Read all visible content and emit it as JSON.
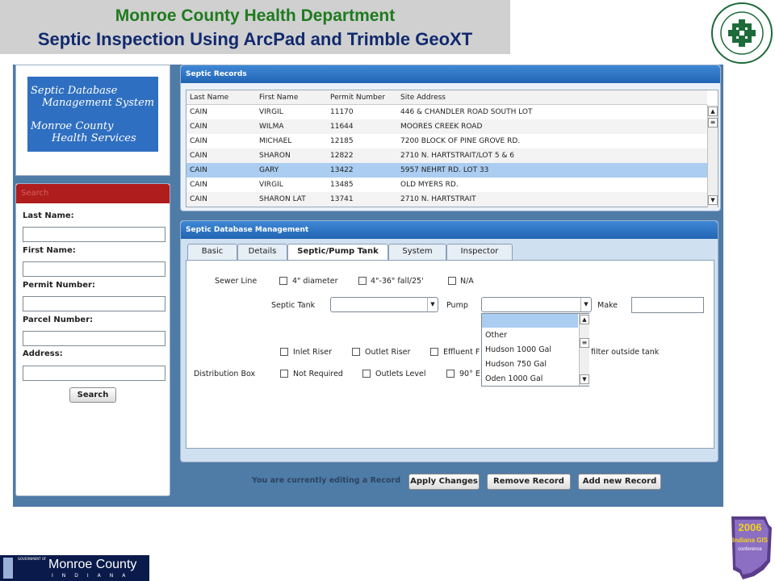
{
  "slide": {
    "title_line1": "Monroe County Health Department",
    "title_line2": "Septic Inspection Using ArcPad and Trimble GeoXT",
    "seal_text_top": "MONROE 1965 COUNTY",
    "seal_text_bottom": "HEALTH DEPARTMENT",
    "footer_logo": {
      "small": "GOVERNMENT OF",
      "name": "Monroe County",
      "state": "INDIANA"
    },
    "conference_badge": {
      "year": "2006",
      "line1": "Indiana GIS",
      "line2": "conference"
    }
  },
  "logo": {
    "line1": "Septic Database",
    "line2": "Management System",
    "line3": "Monroe County",
    "line4": "Health Services"
  },
  "search": {
    "header": "Search",
    "fields": [
      {
        "label": "Last Name:",
        "value": ""
      },
      {
        "label": "First Name:",
        "value": ""
      },
      {
        "label": "Permit Number:",
        "value": ""
      },
      {
        "label": "Parcel Number:",
        "value": ""
      },
      {
        "label": "Address:",
        "value": ""
      }
    ],
    "button": "Search"
  },
  "records": {
    "header": "Septic Records",
    "columns": [
      "Last Name",
      "First Name",
      "Permit Number",
      "Site Address"
    ],
    "rows": [
      [
        "CAIN",
        "VIRGIL",
        "11170",
        "446 & CHANDLER ROAD SOUTH LOT"
      ],
      [
        "CAIN",
        "WILMA",
        "11644",
        "MOORES CREEK ROAD"
      ],
      [
        "CAIN",
        "MICHAEL",
        "12185",
        "7200 BLOCK OF PINE GROVE RD."
      ],
      [
        "CAIN",
        "SHARON",
        "12822",
        "2710 N. HARTSTRAIT/LOT 5 & 6"
      ],
      [
        "CAIN",
        "GARY",
        "13422",
        "5957 NEHRT RD.  LOT  33"
      ],
      [
        "CAIN",
        "VIRGIL",
        "13485",
        "OLD MYERS RD."
      ],
      [
        "CAIN",
        "SHARON LAT",
        "13741",
        "2710 N. HARTSTRAIT"
      ]
    ],
    "selected_row": 4
  },
  "management": {
    "header": "Septic Database Management",
    "tabs": [
      "Basic",
      "Details",
      "Septic/Pump Tank",
      "System",
      "Inspector"
    ],
    "active_tab": "Septic/Pump Tank",
    "sewer_line": {
      "label": "Sewer Line",
      "options": [
        "4\" diameter",
        "4\"-36\" fall/25'",
        "N/A"
      ]
    },
    "septic_tank": {
      "label": "Septic Tank",
      "value": ""
    },
    "pump": {
      "label": "Pump",
      "value": ""
    },
    "make": {
      "label": "Make",
      "value": ""
    },
    "pump_options": [
      "",
      "Other",
      "Hudson 1000 Gal",
      "Hudson 750 Gal",
      "Oden 1000 Gal"
    ],
    "riser_row": {
      "options": [
        "Inlet Riser",
        "Outlet Riser",
        "Effluent F"
      ],
      "trailing_text": "filter outside tank"
    },
    "distribution_box": {
      "label": "Distribution Box",
      "options": [
        "Not Required",
        "Outlets Level",
        "90° E"
      ]
    }
  },
  "footer": {
    "status": "You are currently editing a Record",
    "buttons": [
      "Apply Changes",
      "Remove Record",
      "Add new Record"
    ]
  }
}
